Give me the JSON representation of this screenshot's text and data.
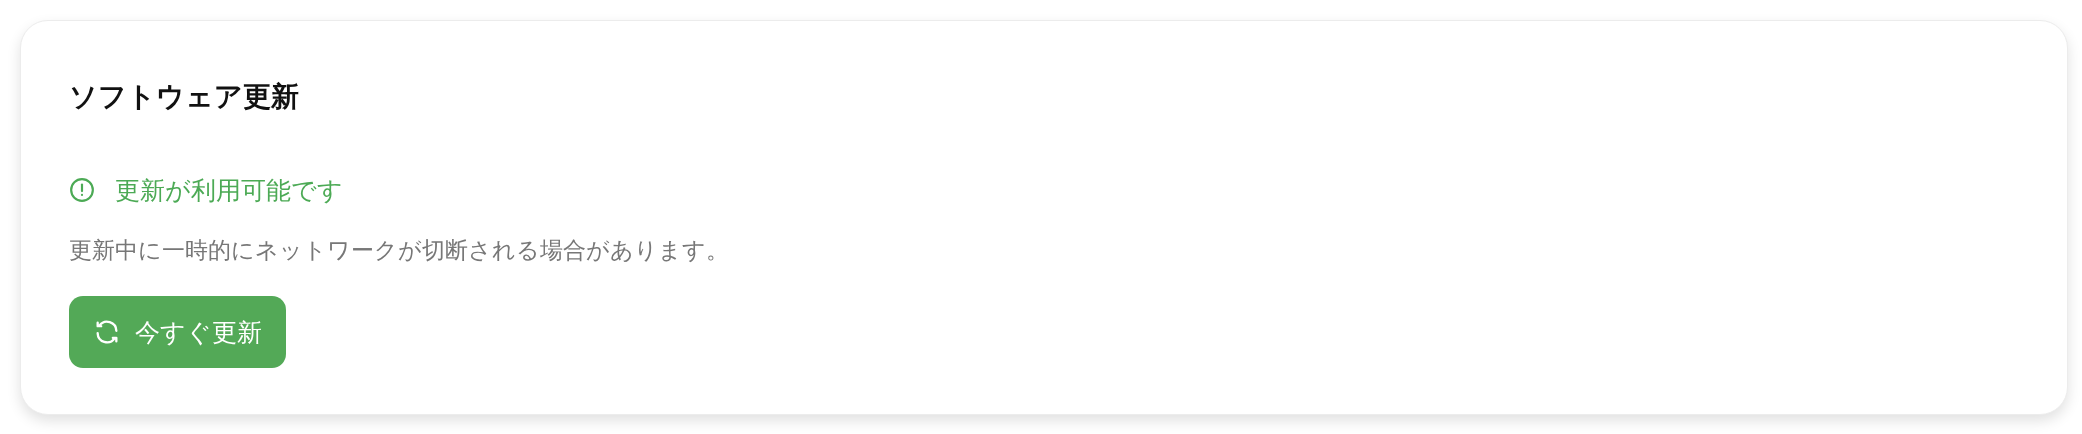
{
  "title": "ソフトウェア更新",
  "status": {
    "kind": "available",
    "text": "更新が利用可能です"
  },
  "description": "更新中に一時的にネットワークが切断される場合があります。",
  "button": {
    "label": "今すぐ更新"
  }
}
